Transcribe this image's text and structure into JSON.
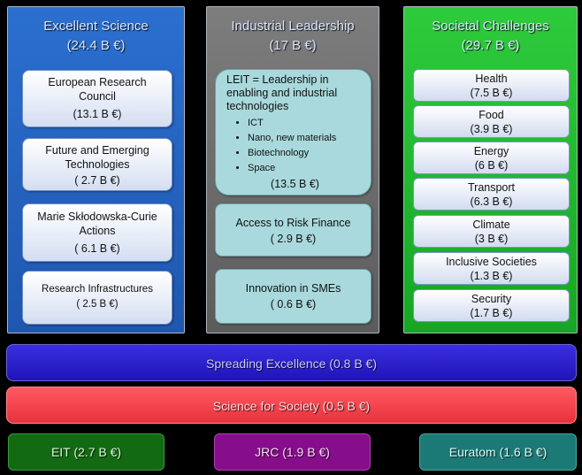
{
  "pillars": [
    {
      "title": "Excellent Science",
      "amount": "(24.4 B €)",
      "boxes": [
        {
          "line1": "European Research",
          "line2": "Council",
          "amount": "(13.1 B €)"
        },
        {
          "line1": "Future and Emerging",
          "line2": "Technologies",
          "amount": "( 2.7 B €)"
        },
        {
          "line1": "Marie Skłodowska-Curie",
          "line2": "Actions",
          "amount": "( 6.1 B €)"
        },
        {
          "line1": "Research Infrastructures",
          "amount": "( 2.5 B €)"
        }
      ]
    },
    {
      "title": "Industrial Leadership",
      "amount": "(17 B €)",
      "leit": {
        "line1": "LEIT = Leadership in",
        "line2": "enabling and industrial",
        "line3": "technologies",
        "items": [
          "ICT",
          "Nano, new materials",
          "Biotechnology",
          "Space"
        ],
        "amount": "(13.5 B €)"
      },
      "boxes": [
        {
          "line1": "Access to Risk Finance",
          "amount": "( 2.9 B €)"
        },
        {
          "line1": "Innovation in SMEs",
          "amount": "( 0.6 B €)"
        }
      ]
    },
    {
      "title": "Societal Challenges",
      "amount": "(29.7 B €)",
      "boxes": [
        {
          "line1": "Health",
          "amount": "(7.5 B €)"
        },
        {
          "line1": "Food",
          "amount": "(3.9 B €)"
        },
        {
          "line1": "Energy",
          "amount": "(6 B €)"
        },
        {
          "line1": "Transport",
          "amount": "(6.3 B €)"
        },
        {
          "line1": "Climate",
          "amount": "(3 B €)"
        },
        {
          "line1": "Inclusive Societies",
          "amount": "(1.3 B €)"
        },
        {
          "line1": "Security",
          "amount": "(1.7 B €)"
        }
      ]
    }
  ],
  "bars": {
    "spreading": "Spreading Excellence  (0.8 B €)",
    "science": "Science for Society  (0.5 B €)"
  },
  "bottom": {
    "eit": "EIT  (2.7 B €)",
    "jrc": "JRC  (1.9 B €)",
    "euratom": "Euratom  (1.6 B €)"
  }
}
